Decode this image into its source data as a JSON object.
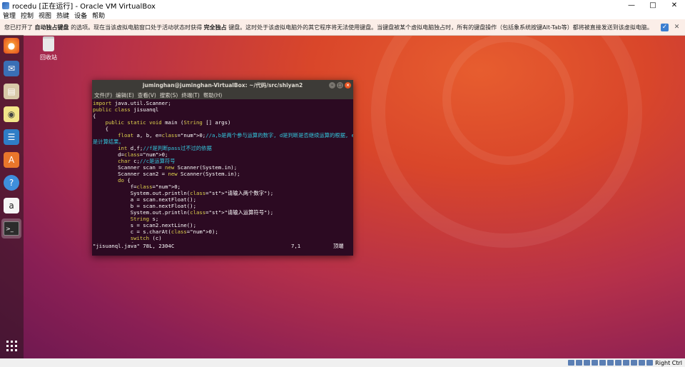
{
  "host": {
    "title": "rocedu [正在运行] - Oracle VM VirtualBox",
    "menu": [
      "管理",
      "控制",
      "视图",
      "热键",
      "设备",
      "帮助"
    ],
    "host_key": "Right Ctrl"
  },
  "notification": {
    "part1": "您已打开了",
    "bold1": "自动独占键盘",
    "part2": "的选项。现在当该虚拟电脑窗口处于活动状态时获得",
    "bold2": "完全独占",
    "part3": "键盘。这时处于该虚拟电脑外的其它程序将无法使用键盘。当键盘被某个虚拟电脑独占时，所有的键盘操作（包括象系统按键Alt-Tab等）都将被直接发送到该虚拟电脑。"
  },
  "desktop": {
    "trash_label": "回收站"
  },
  "dock": {
    "apps": [
      "firefox-icon",
      "thunderbird-icon",
      "files-icon",
      "rhythmbox-icon",
      "libreoffice-writer-icon",
      "software-center-icon",
      "help-icon",
      "amazon-icon",
      "terminal-icon"
    ]
  },
  "terminal": {
    "title": "juminghan@juminghan-VirtualBox: ~/代码/src/shiyan2",
    "menu": [
      "文件(F)",
      "编辑(E)",
      "查看(V)",
      "搜索(S)",
      "终端(T)",
      "帮助(H)"
    ],
    "status_file": "\"jisuanql.java\" 78L, 2304C",
    "status_pos": "7,1",
    "status_top": "顶端"
  },
  "code_lines": [
    "import java.util.Scanner;",
    "public class jisuanql",
    "{",
    "    public static void main (String [] args)",
    "    {",
    "        float a, b, e=0;//a,b是两个参与运算的数字, d是判断是否继续运算的根据, e>",
    "是计算结果。",
    "        int d,f;//f是判断pass过不过的依据",
    "        d=0;",
    "        char c;//c是运算符号",
    "        Scanner scan = new Scanner(System.in);",
    "        Scanner scan2 = new Scanner(System.in);",
    "        do {",
    "            f=0;",
    "            System.out.println(\"请输入两个数字\");",
    "            a = scan.nextFloat();",
    "            b = scan.nextFloat();",
    "            System.out.println(\"请输入运算符号\");",
    "            String s;",
    "            s = scan2.nextLine();",
    "            c = s.charAt(0);",
    "            switch (c)",
    "            {"
  ],
  "colors": {
    "term_bg": "#2c0a22",
    "keyword": "#dfd24d",
    "type": "#8ae0ff",
    "comment": "#33c7de",
    "string": "#f06a6a",
    "ubuntu_orange": "#e95420"
  }
}
